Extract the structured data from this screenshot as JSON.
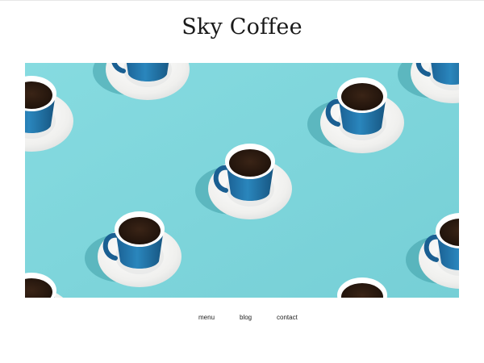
{
  "site": {
    "title": "Sky Coffee"
  },
  "hero": {
    "image": "coffee-cups-on-turquoise"
  },
  "nav": {
    "items": [
      {
        "label": "menu"
      },
      {
        "label": "blog"
      },
      {
        "label": "contact"
      }
    ]
  },
  "colors": {
    "hero_background": "#7fd6dc",
    "cup_blue": "#1f6fa3",
    "saucer": "#f4f4f2",
    "coffee": "#2b1a10",
    "text": "#1a1a1a"
  }
}
